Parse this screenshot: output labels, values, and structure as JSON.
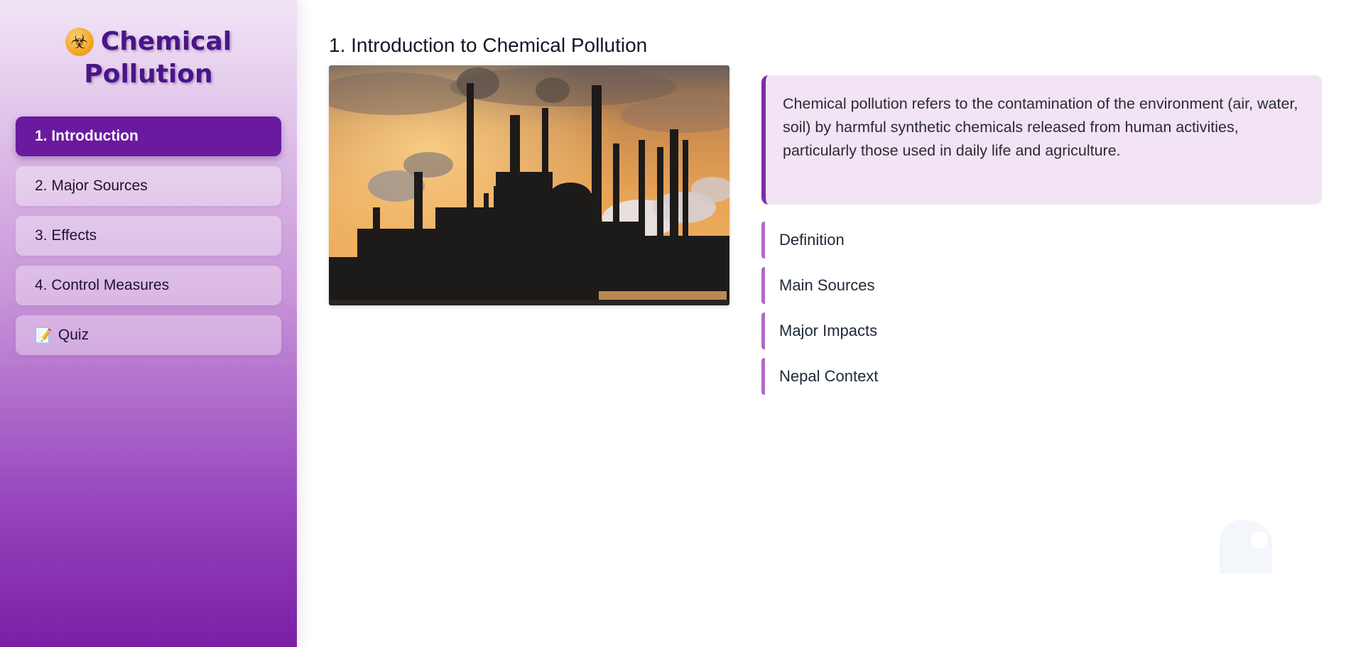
{
  "sidebar": {
    "brand": {
      "icon": "biohazard-icon",
      "icon_glyph": "☣",
      "title_line1": "Chemical",
      "title_line2": "Pollution"
    },
    "items": [
      {
        "label": "1. Introduction",
        "active": true
      },
      {
        "label": "2. Major Sources",
        "active": false
      },
      {
        "label": "3. Effects",
        "active": false
      },
      {
        "label": "4. Control Measures",
        "active": false
      },
      {
        "label": "Quiz",
        "icon": "memo-icon",
        "icon_glyph": "📝",
        "active": false
      }
    ]
  },
  "main": {
    "title": "1. Introduction to Chemical Pollution",
    "image": {
      "subject": "industrial-refinery-smokestacks-at-sunset"
    },
    "definition": "Chemical pollution refers to the contamination of the environment (air, water, soil) by harmful synthetic chemicals released from human activities, particularly those used in daily life and agriculture.",
    "topics": [
      {
        "label": "Definition"
      },
      {
        "label": "Main Sources"
      },
      {
        "label": "Major Impacts"
      },
      {
        "label": "Nepal Context"
      }
    ]
  },
  "colors": {
    "accent": "#6a1a9e",
    "brand_text": "#4a1586",
    "definition_bg": "#f2e3f5",
    "topic_border": "#b06ac8"
  }
}
